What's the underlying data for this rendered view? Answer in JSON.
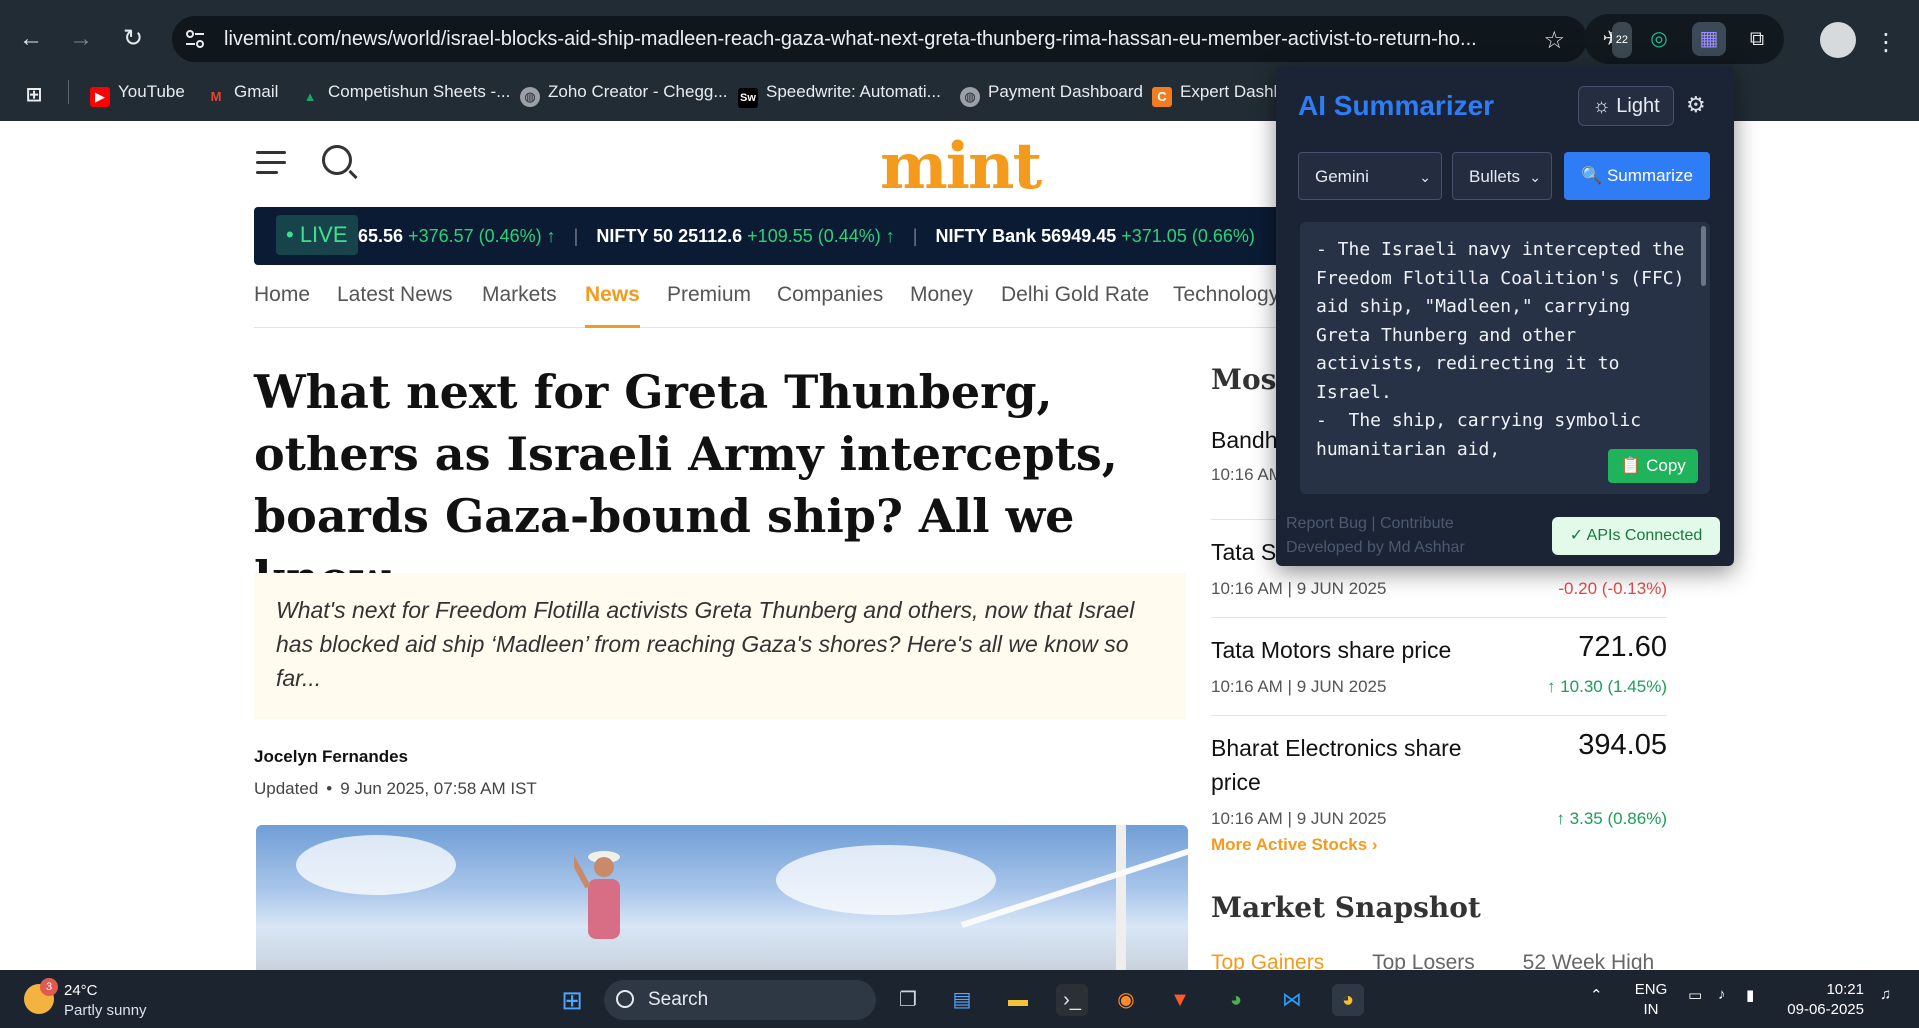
{
  "browser": {
    "url": "livemint.com/news/world/israel-blocks-aid-ship-madleen-reach-gaza-what-next-greta-thunberg-rima-hassan-eu-member-activist-to-return-ho...",
    "extension_badge": "22",
    "bookmarks": [
      {
        "label": "YouTube",
        "icon": "youtube-icon",
        "color": "#ff0000"
      },
      {
        "label": "Gmail",
        "icon": "gmail-icon",
        "color": "#ea4335"
      },
      {
        "label": "Competishun Sheets -...",
        "icon": "google-drive-icon",
        "color": "#1ea362"
      },
      {
        "label": "Zoho Creator - Chegg...",
        "icon": "globe-icon",
        "color": "#9aa0a6"
      },
      {
        "label": "Speedwrite: Automati...",
        "icon": "speedwrite-icon",
        "color": "#000000"
      },
      {
        "label": "Payment Dashboard",
        "icon": "globe-icon",
        "color": "#9aa0a6"
      },
      {
        "label": "Expert Dashb",
        "icon": "chegg-icon",
        "color": "#f47c20"
      }
    ]
  },
  "site": {
    "logo": "mint",
    "ticker": {
      "live_label": "• LIVE",
      "items": [
        {
          "name": "",
          "value": "65.56",
          "change": "+376.57 (0.46%) ↑"
        },
        {
          "name": "NIFTY 50",
          "value": "25112.6",
          "change": "+109.55 (0.44%) ↑"
        },
        {
          "name": "NIFTY Bank",
          "value": "56949.45",
          "change": "+371.05 (0.66%)"
        }
      ]
    },
    "nav": [
      "Home",
      "Latest News",
      "Markets",
      "News",
      "Premium",
      "Companies",
      "Money",
      "Delhi Gold Rate",
      "Technology"
    ],
    "active_nav": "News"
  },
  "article": {
    "headline": "What next for Greta Thunberg, others as Israeli Army intercepts, boards Gaza-bound ship? All we know",
    "summary": "What's next for Freedom Flotilla activists Greta Thunberg and others, now that Israel has blocked aid ship ‘Madleen’ from reaching Gaza's shores? Here's all we know so far...",
    "author": "Jocelyn Fernandes",
    "updated_label": "Updated",
    "updated_time": "9 Jun 2025, 07:58 AM IST"
  },
  "sidebar": {
    "most_title": "Most",
    "stocks": [
      {
        "name": "Bandh",
        "price": "",
        "time": "10:16 AM",
        "change": "",
        "direction": "up"
      },
      {
        "name": "Tata S",
        "price": "",
        "time": "10:16 AM | 9 JUN 2025",
        "change": "-0.20 (-0.13%)",
        "direction": "down"
      },
      {
        "name": "Tata Motors share price",
        "price": "721.60",
        "time": "10:16 AM | 9 JUN 2025",
        "change": "10.30 (1.45%)",
        "direction": "up"
      },
      {
        "name": "Bharat Electronics share price",
        "price": "394.05",
        "time": "10:16 AM | 9 JUN 2025",
        "change": "3.35 (0.86%)",
        "direction": "up"
      }
    ],
    "more_link": "More Active Stocks ›",
    "snapshot_title": "Market Snapshot",
    "snapshot_tabs": [
      "Top Gainers",
      "Top Losers",
      "52 Week High"
    ]
  },
  "popup": {
    "title": "AI Summarizer",
    "theme_button": "Light",
    "model": "Gemini",
    "format": "Bullets",
    "summarize_button": "🔍 Summarize",
    "result": "- The Israeli navy intercepted the Freedom Flotilla Coalition's (FFC) aid ship, \"Madleen,\" carrying Greta Thunberg and other activists, redirecting it to Israel.\n-  The ship, carrying symbolic humanitarian aid,",
    "copy_button": "📋 Copy",
    "footer_links": "Report Bug | Contribute",
    "footer_dev": "Developed by Md Ashhar",
    "api_status": "✓  APIs Connected",
    "accent_color": "#2f7df6"
  },
  "taskbar": {
    "weather_temp": "24°C",
    "weather_desc": "Partly sunny",
    "weather_badge": "3",
    "search_label": "Search",
    "lang_top": "ENG",
    "lang_bottom": "IN",
    "time": "10:21",
    "date": "09-06-2025"
  }
}
